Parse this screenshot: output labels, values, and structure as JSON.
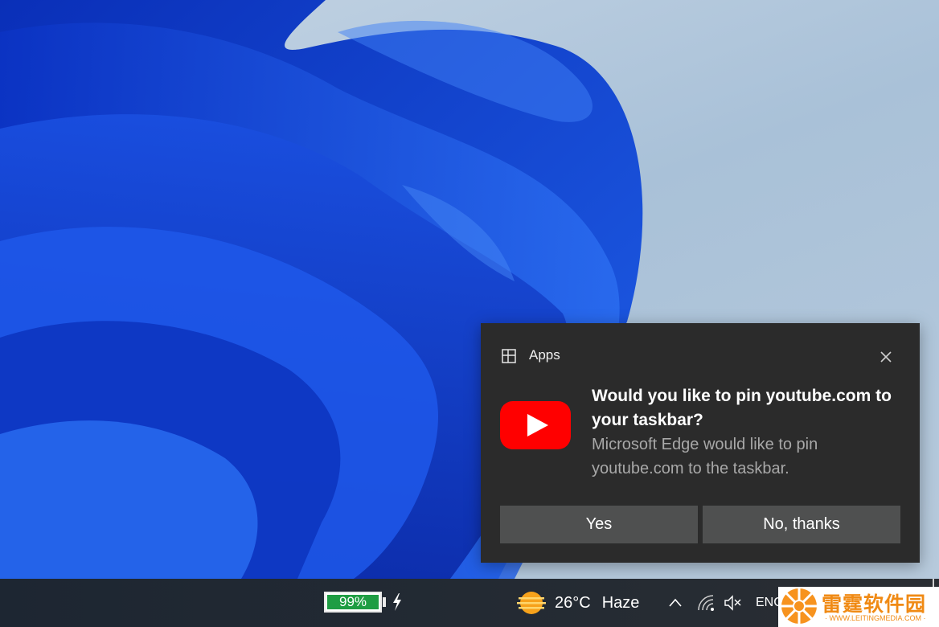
{
  "notification": {
    "app_name": "Apps",
    "title": "Would you like to pin youtube.com to your taskbar?",
    "body": "Microsoft Edge would like to pin youtube.com to the taskbar.",
    "buttons": {
      "yes": "Yes",
      "no": "No, thanks"
    },
    "icons": {
      "app": "apps-grid-icon",
      "close": "close-icon",
      "logo": "youtube-logo-icon"
    }
  },
  "taskbar": {
    "battery_percent": "99%",
    "battery_level": 0.99,
    "temperature": "26°C",
    "weather": "Haze",
    "language": "ENG",
    "icons": [
      "charging-icon",
      "weather-haze-icon",
      "chevron-up-icon",
      "wifi-icon",
      "volume-muted-icon"
    ]
  },
  "watermark": {
    "title": "雷霆软件园",
    "subtitle": "· WWW.LEITINGMEDIA.COM ·"
  },
  "colors": {
    "toast_bg": "#2b2b2b",
    "button_bg": "#4f5050",
    "youtube_red": "#ff0000",
    "battery_green": "#1f9d43",
    "watermark_orange": "#f08a14"
  }
}
